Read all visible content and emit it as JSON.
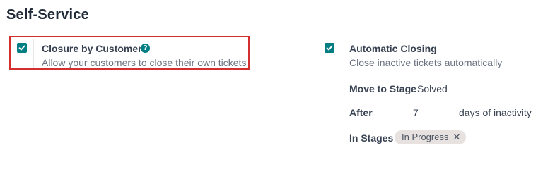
{
  "section": {
    "title": "Self-Service"
  },
  "closure_by_customers": {
    "checked": true,
    "title": "Closure by Customers",
    "help_icon": "?",
    "description": "Allow your customers to close their own tickets"
  },
  "automatic_closing": {
    "checked": true,
    "title": "Automatic Closing",
    "description": "Close inactive tickets automatically",
    "move_to_stage": {
      "label": "Move to Stage",
      "value": "Solved"
    },
    "after": {
      "label": "After",
      "value": "7",
      "suffix": "days of inactivity"
    },
    "in_stages": {
      "label": "In Stages",
      "tags": [
        {
          "label": "In Progress",
          "remove": "✕"
        }
      ]
    }
  },
  "colors": {
    "accent": "#017e84",
    "highlight": "#d32f2f",
    "tag_bg": "#e7e2df"
  },
  "icons": {
    "checkbox": "check-icon",
    "help": "question-circle-icon",
    "tag_remove": "close-icon"
  }
}
